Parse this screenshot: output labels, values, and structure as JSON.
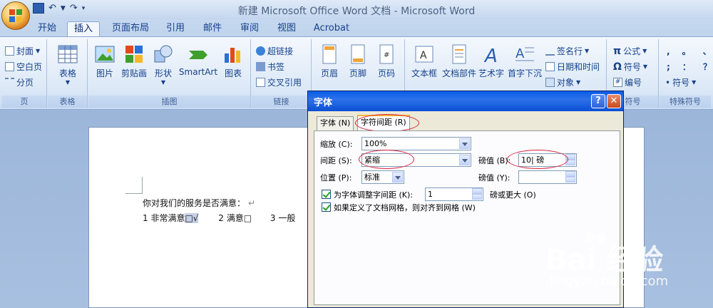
{
  "window": {
    "title": "新建 Microsoft Office Word 文档 - Microsoft Word"
  },
  "tabs": [
    "开始",
    "插入",
    "页面布局",
    "引用",
    "邮件",
    "审阅",
    "视图",
    "Acrobat"
  ],
  "active_tab": "插入",
  "ribbon": {
    "pages": {
      "label": "页",
      "items": [
        "封面",
        "空白页",
        "分页"
      ]
    },
    "tables": {
      "label": "表格",
      "items": [
        "表格"
      ]
    },
    "illustrations": {
      "label": "插图",
      "items": [
        "图片",
        "剪贴画",
        "形状",
        "SmartArt",
        "图表"
      ]
    },
    "links": {
      "label": "链接",
      "items": [
        "超链接",
        "书签",
        "交叉引用"
      ]
    },
    "header_footer": {
      "items": [
        "页眉",
        "页脚",
        "页码"
      ]
    },
    "text": {
      "items": [
        "文本框",
        "文档部件",
        "艺术字",
        "首字下沉"
      ],
      "small": [
        "签名行",
        "日期和时间",
        "对象"
      ]
    },
    "symbols": {
      "label": "符号",
      "items": [
        "公式",
        "符号",
        "编号"
      ]
    },
    "special": {
      "label": "特殊符号",
      "items": [
        "符号"
      ],
      "chars": [
        ",",
        "。",
        "、",
        ";",
        "：",
        "？"
      ]
    }
  },
  "document": {
    "line1": "你对我们的服务是否满意：",
    "line1_mark": "↵",
    "opt1": "1 非常满意",
    "opt1_sel": "□√",
    "opt2": "2 满意□",
    "opt3": "3 一般"
  },
  "dialog": {
    "title": "字体",
    "help": "?",
    "close": "✕",
    "tabs": [
      "字体 (N)",
      "字符间距 (R)"
    ],
    "active_tab": "字符间距 (R)",
    "fields": {
      "scale_label": "缩放 (C):",
      "scale_value": "100%",
      "spacing_label": "间距 (S):",
      "spacing_value": "紧缩",
      "spacing_by_label": "磅值 (B):",
      "spacing_by_value": "10| 磅",
      "position_label": "位置 (P):",
      "position_value": "标准",
      "position_by_label": "磅值 (Y):",
      "position_by_value": "",
      "kerning_label": "为字体调整字间距 (K):",
      "kerning_value": "1",
      "kerning_suffix": "磅或更大 (O)",
      "grid_label": "如果定义了文档网格，则对齐到网格 (W)"
    }
  },
  "watermark": {
    "brand": "Bai  经验",
    "url": "jingyan.baidu.com"
  },
  "colors": {
    "accent": "#15428b",
    "dialog_title": "#0a5ce8",
    "highlight_circle": "#d9233c"
  }
}
